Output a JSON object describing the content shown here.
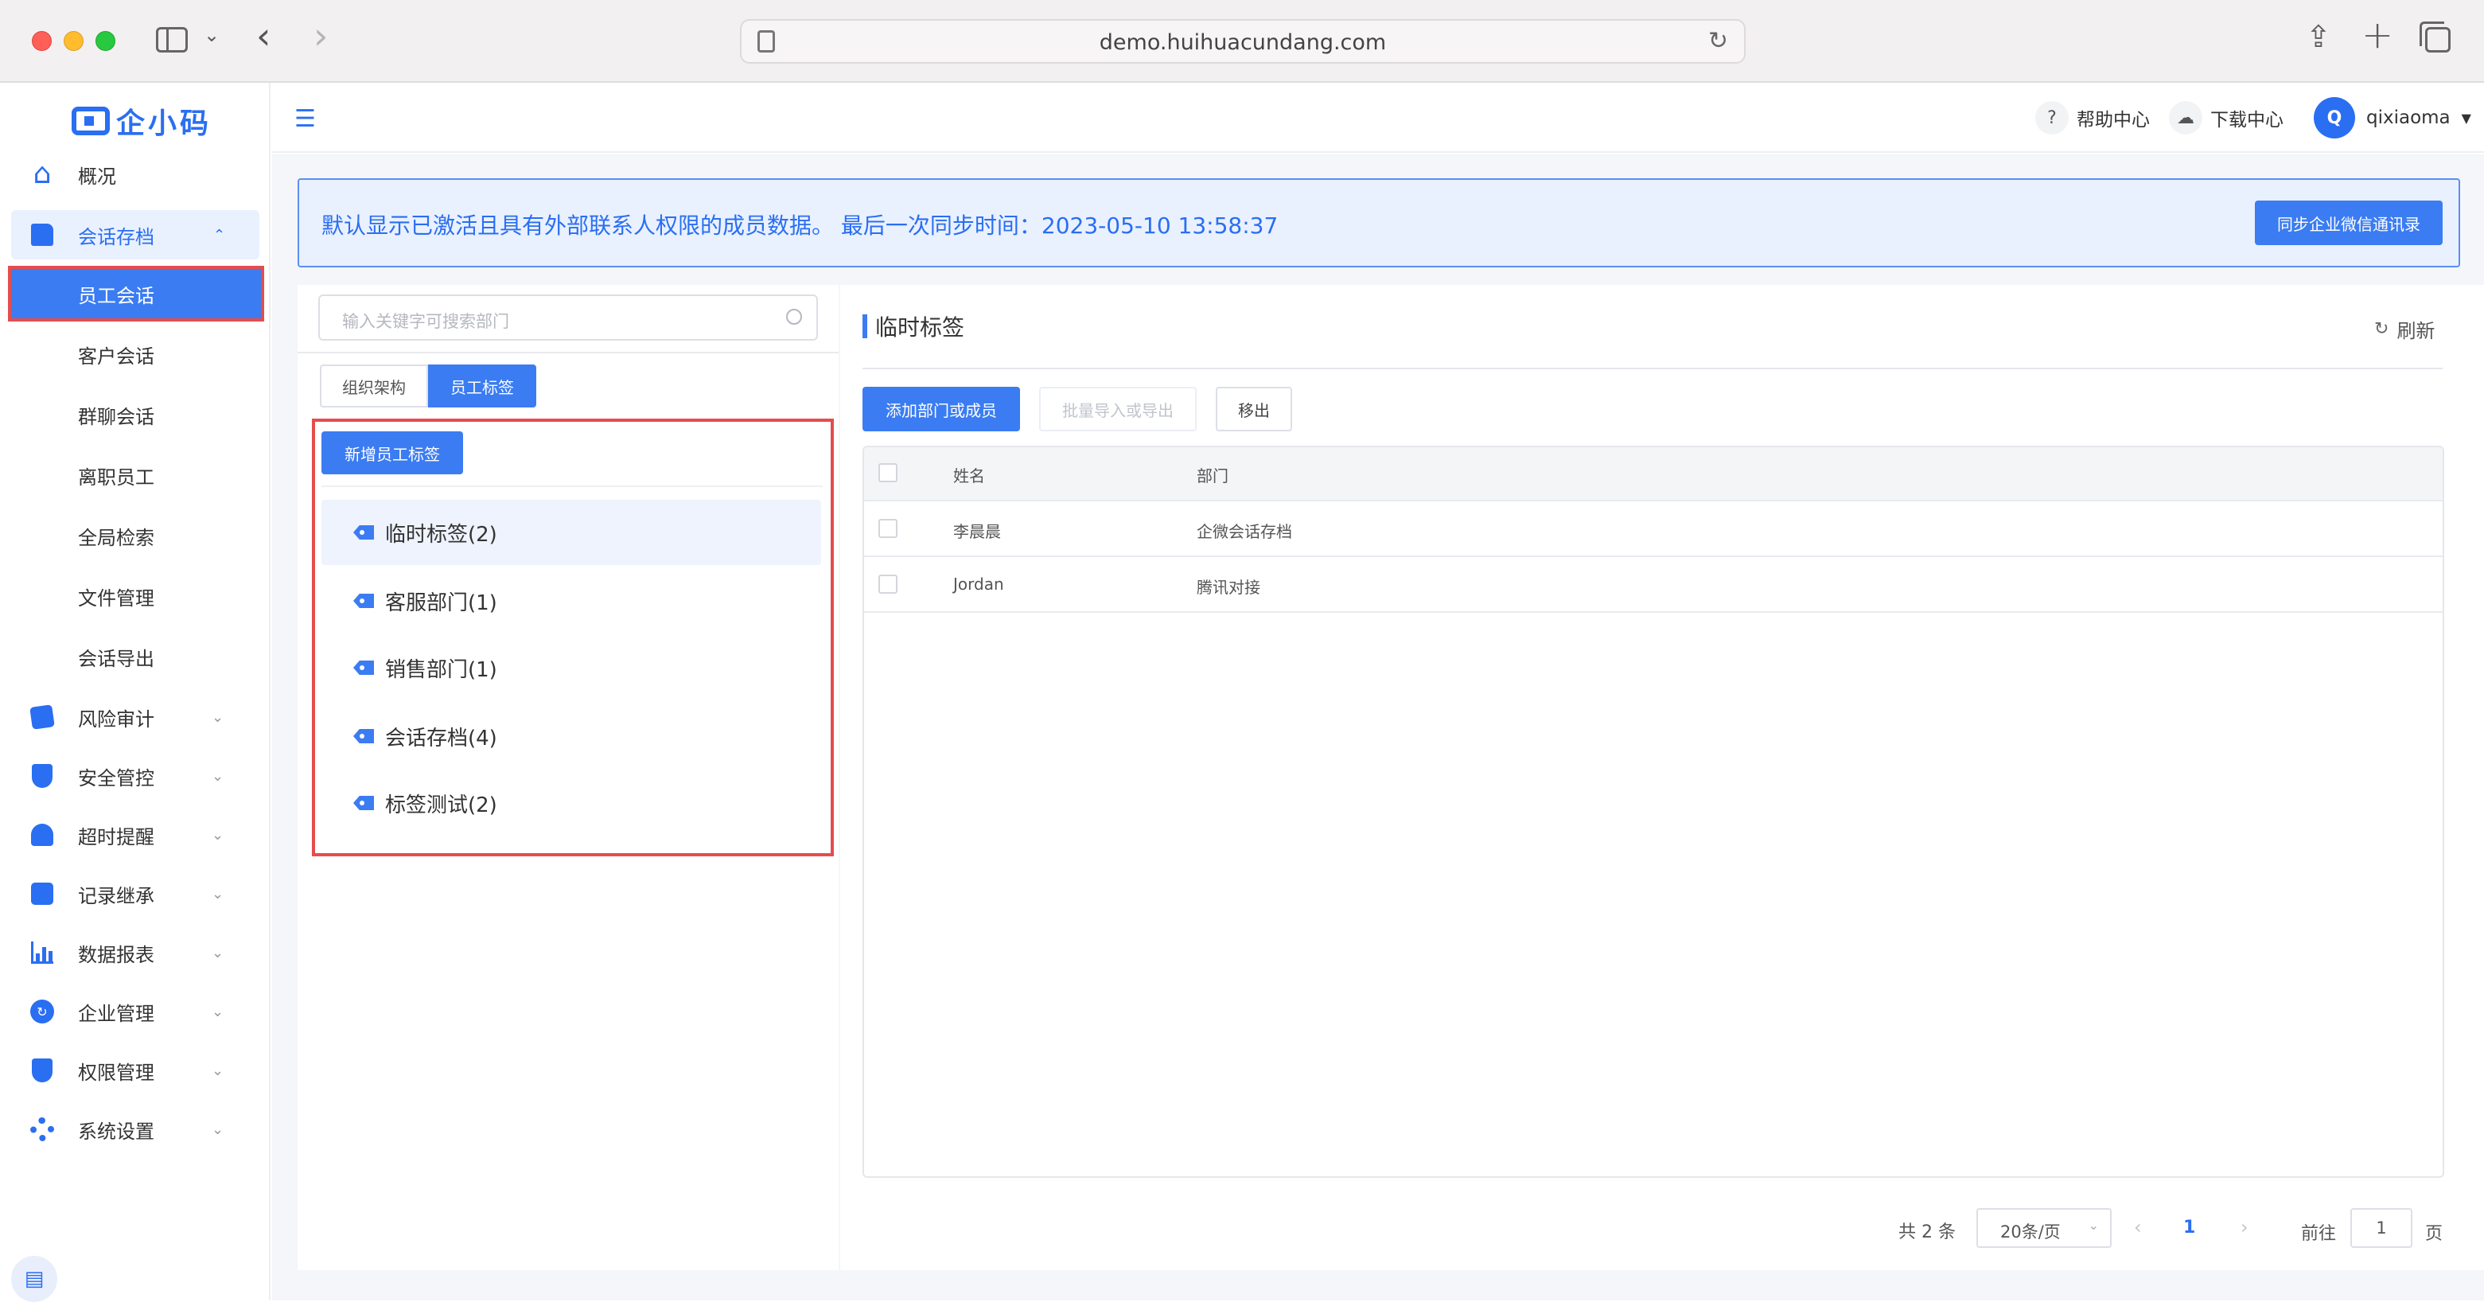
{
  "browser": {
    "url": "demo.huihuacundang.com"
  },
  "brand": {
    "logo_text": "企小码",
    "accent": "#2a6ef2",
    "highlight_outline": "#e44d4d"
  },
  "sidebar": {
    "items": [
      {
        "label": "概况",
        "icon": "home-icon"
      },
      {
        "label": "会话存档",
        "icon": "folder-icon"
      },
      {
        "label": "风险审计",
        "icon": "audit-icon"
      },
      {
        "label": "安全管控",
        "icon": "shield-icon"
      },
      {
        "label": "超时提醒",
        "icon": "bell-icon"
      },
      {
        "label": "记录继承",
        "icon": "inherit-icon"
      },
      {
        "label": "数据报表",
        "icon": "bar-chart-icon"
      },
      {
        "label": "企业管理",
        "icon": "enterprise-icon"
      },
      {
        "label": "权限管理",
        "icon": "permission-icon"
      },
      {
        "label": "系统设置",
        "icon": "gear-icon"
      }
    ],
    "sub_items": [
      {
        "label": "员工会话"
      },
      {
        "label": "客户会话"
      },
      {
        "label": "群聊会话"
      },
      {
        "label": "离职员工"
      },
      {
        "label": "全局检索"
      },
      {
        "label": "文件管理"
      },
      {
        "label": "会话导出"
      }
    ]
  },
  "header": {
    "help": "帮助中心",
    "download": "下载中心",
    "avatar_letter": "Q",
    "username": "qixiaoma"
  },
  "notice": {
    "text": "默认显示已激活且具有外部联系人权限的成员数据。 最后一次同步时间：2023-05-10 13:58:37",
    "sync_button": "同步企业微信通讯录"
  },
  "left_panel": {
    "search_placeholder": "输入关键字可搜索部门",
    "tabs": [
      "组织架构",
      "员工标签"
    ],
    "new_tag_button": "新增员工标签",
    "tags": [
      {
        "label": "临时标签(2)"
      },
      {
        "label": "客服部门(1)"
      },
      {
        "label": "销售部门(1)"
      },
      {
        "label": "会话存档(4)"
      },
      {
        "label": "标签测试(2)"
      }
    ]
  },
  "right_panel": {
    "title": "临时标签",
    "refresh": "刷新",
    "buttons": {
      "add": "添加部门或成员",
      "batch": "批量导入或导出",
      "remove": "移出"
    },
    "table": {
      "columns": [
        "姓名",
        "部门"
      ],
      "rows": [
        {
          "name": "李晨晨",
          "dept": "企微会话存档"
        },
        {
          "name": "Jordan",
          "dept": "腾讯对接"
        }
      ]
    },
    "pagination": {
      "total": "共 2 条",
      "page_size": "20条/页",
      "current_page": "1",
      "goto_prefix": "前往",
      "goto_value": "1",
      "goto_suffix": "页"
    }
  }
}
